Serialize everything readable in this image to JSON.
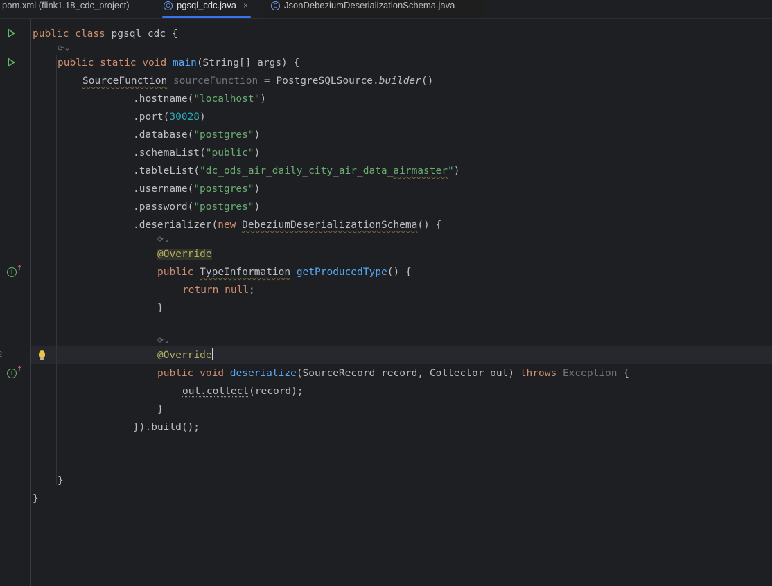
{
  "tabs": [
    {
      "label": "pom.xml (flink1.18_cdc_project)",
      "active": false,
      "icon": null
    },
    {
      "label": "pgsql_cdc.java",
      "active": true,
      "icon": "class-icon",
      "close": "×"
    },
    {
      "label": "JsonDebeziumDeserializationSchema.java",
      "active": false,
      "icon": "class-icon"
    }
  ],
  "class_icon_glyph": "C",
  "inlay_hint_glyph": "⟳⌄",
  "current_line_number": "2",
  "code": {
    "l1": {
      "kw1": "public",
      "kw2": "class",
      "name": "pgsql_cdc",
      "rest": " {"
    },
    "l2": {
      "kw1": "public",
      "kw2": "static",
      "kw3": "void",
      "fn": "main",
      "rest": "(String[] args) {"
    },
    "l3": {
      "type": "SourceFunction",
      "var": "sourceFunction",
      "eq": " = PostgreSQLSource.",
      "method": "builder",
      "rest": "()"
    },
    "l4": {
      "pre": ".hostname(",
      "str": "\"localhost\"",
      "post": ")"
    },
    "l5": {
      "pre": ".port(",
      "num": "30028",
      "post": ")"
    },
    "l6": {
      "pre": ".database(",
      "str": "\"postgres\"",
      "post": ")"
    },
    "l7": {
      "pre": ".schemaList(",
      "str": "\"public\"",
      "post": ")"
    },
    "l8": {
      "pre": ".tableList(",
      "str_a": "\"dc_ods_air_daily_city_air_data_",
      "str_b": "airmaster",
      "str_c": "\"",
      "post": ")"
    },
    "l9": {
      "pre": ".username(",
      "str": "\"postgres\"",
      "post": ")"
    },
    "l10": {
      "pre": ".password(",
      "str": "\"postgres\"",
      "post": ")"
    },
    "l11": {
      "pre": ".deserializer(",
      "kw": "new",
      "type": "DebeziumDeserializationSchema",
      "post": "() {"
    },
    "l12": {
      "ann": "@Override"
    },
    "l13": {
      "kw": "public",
      "type": "TypeInformation",
      "fn": "getProducedType",
      "post": "() {"
    },
    "l14": {
      "kw1": "return",
      "kw2": "null",
      "post": ";"
    },
    "l15": {
      "text": "}"
    },
    "l16": {
      "ann": "@Override"
    },
    "l17": {
      "kw1": "public",
      "kw2": "void",
      "fn": "deserialize",
      "mid": "(SourceRecord record, Collector out) ",
      "kw3": "throws",
      "exc": "Exception",
      "post": " {"
    },
    "l18": {
      "pre": "out.",
      "method": "collect",
      "post": "(record);"
    },
    "l19": {
      "text": "}"
    },
    "l20": {
      "text": "}).build();"
    },
    "l21": {
      "text": "}"
    },
    "l22": {
      "text": "}"
    }
  }
}
